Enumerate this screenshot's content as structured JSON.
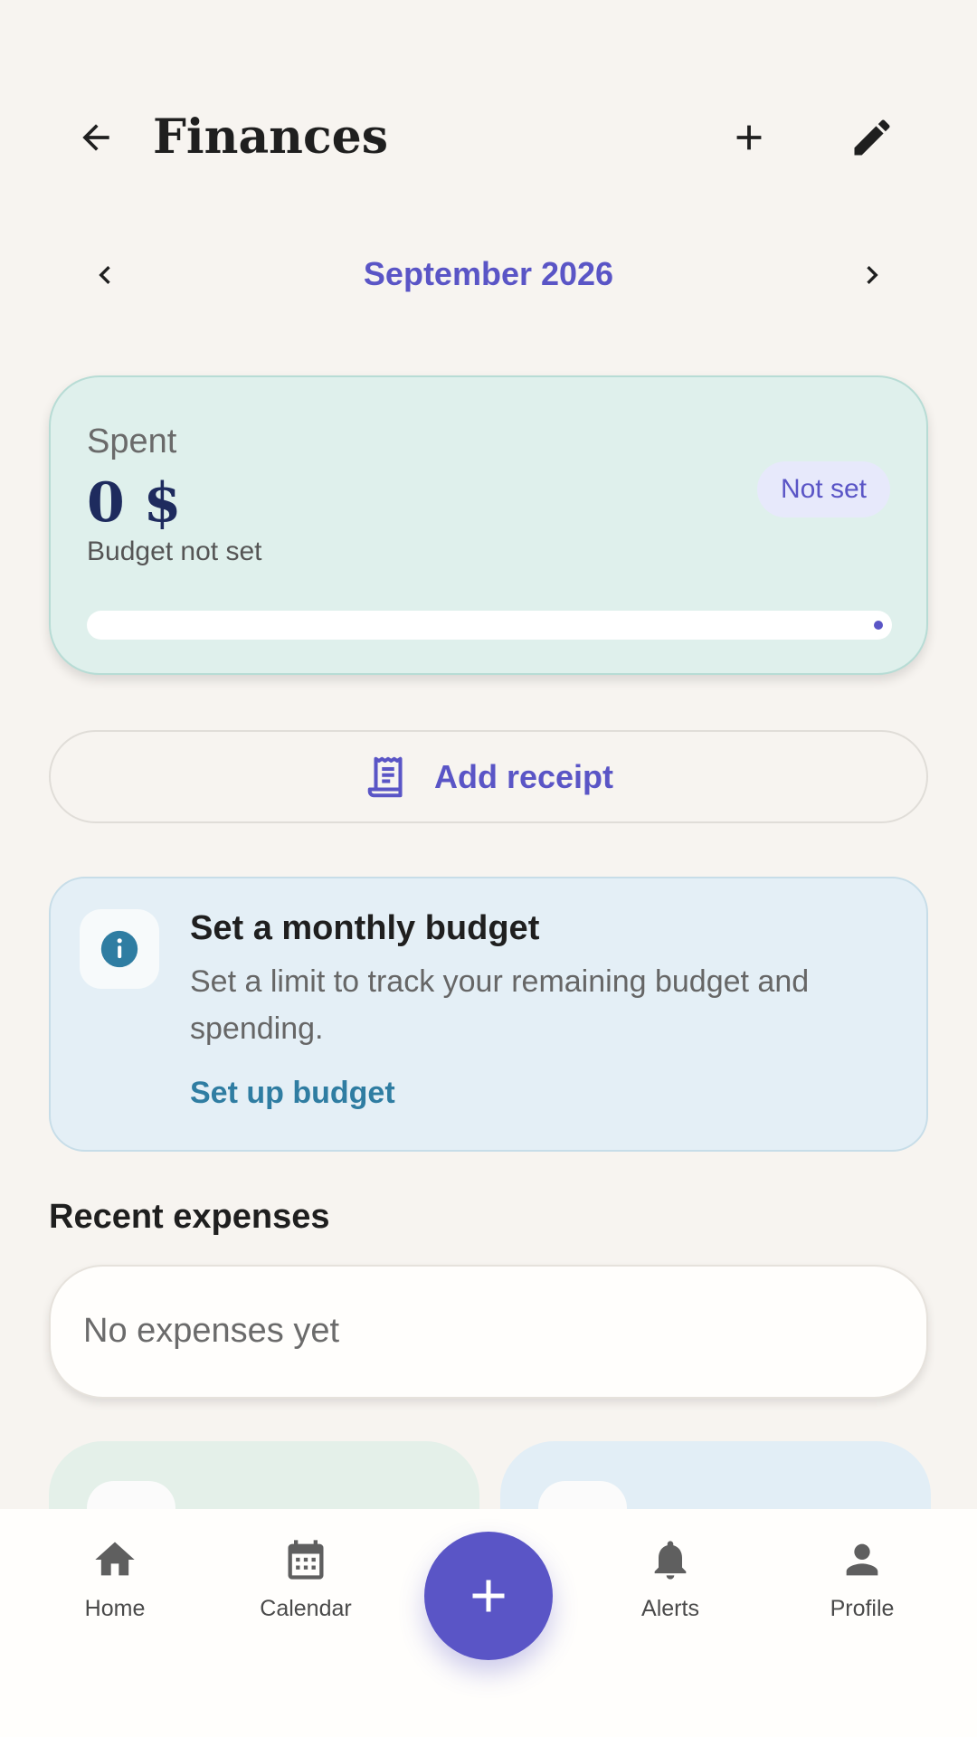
{
  "header": {
    "title": "Finances",
    "back_icon": "arrow-left-icon",
    "add_icon": "plus-icon",
    "edit_icon": "pencil-icon"
  },
  "month_nav": {
    "label": "September 2026"
  },
  "summary": {
    "spent_label": "Spent",
    "spent_amount": "0 $",
    "budget_status": "Budget not set",
    "badge": "Not set",
    "progress": 0
  },
  "add_receipt": {
    "label": "Add receipt",
    "icon": "receipt-icon"
  },
  "budget_info": {
    "title": "Set a monthly budget",
    "description": "Set a limit to track your remaining budget and spending.",
    "action": "Set up budget",
    "icon": "info-icon"
  },
  "recent": {
    "title": "Recent expenses",
    "empty_text": "No expenses yet"
  },
  "bottom_nav": {
    "items": [
      {
        "label": "Home",
        "icon": "home-icon"
      },
      {
        "label": "Calendar",
        "icon": "calendar-icon"
      },
      {
        "label": "Alerts",
        "icon": "bell-icon"
      },
      {
        "label": "Profile",
        "icon": "person-icon"
      }
    ],
    "fab_icon": "plus-icon"
  },
  "colors": {
    "accent": "#5a55c6",
    "background": "#f7f4f0",
    "summary_card": "#dff0ec",
    "info_card": "#e4eff6",
    "link": "#2f7da2"
  }
}
